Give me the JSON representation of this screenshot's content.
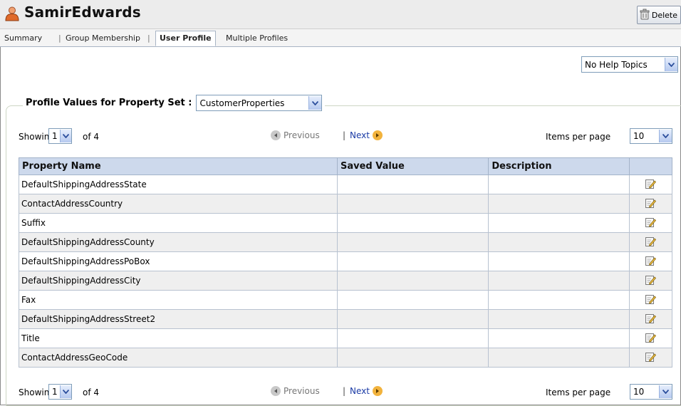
{
  "header": {
    "title": "SamirEdwards",
    "delete_label": "Delete"
  },
  "tabs": [
    {
      "label": "Summary",
      "active": false
    },
    {
      "label": "Group Membership",
      "active": false
    },
    {
      "label": "User Profile",
      "active": true
    },
    {
      "label": "Multiple Profiles",
      "active": false
    }
  ],
  "help": {
    "selected": "No Help Topics"
  },
  "property_set": {
    "label": "Profile Values for Property Set :",
    "selected": "CustomerProperties"
  },
  "pager": {
    "showing_label": "Showing",
    "page": "1",
    "of_label": "of 4",
    "previous_label": "Previous",
    "separator": "|",
    "next_label": "Next",
    "items_per_page_label": "Items per page",
    "items_per_page": "10"
  },
  "table": {
    "columns": [
      "Property Name",
      "Saved Value",
      "Description",
      ""
    ],
    "rows": [
      {
        "name": "DefaultShippingAddressState",
        "value": "",
        "description": ""
      },
      {
        "name": "ContactAddressCountry",
        "value": "",
        "description": ""
      },
      {
        "name": "Suffix",
        "value": "",
        "description": ""
      },
      {
        "name": "DefaultShippingAddressCounty",
        "value": "",
        "description": ""
      },
      {
        "name": "DefaultShippingAddressPoBox",
        "value": "",
        "description": ""
      },
      {
        "name": "DefaultShippingAddressCity",
        "value": "",
        "description": ""
      },
      {
        "name": "Fax",
        "value": "",
        "description": ""
      },
      {
        "name": "DefaultShippingAddressStreet2",
        "value": "",
        "description": ""
      },
      {
        "name": "Title",
        "value": "",
        "description": ""
      },
      {
        "name": "ContactAddressGeoCode",
        "value": "",
        "description": ""
      }
    ]
  },
  "icons": {
    "user": "user-icon",
    "delete": "trash-icon",
    "dropdown": "chevron-down-icon",
    "previous": "arrow-left-circle-icon",
    "next": "arrow-right-circle-icon",
    "edit": "edit-icon"
  },
  "colors": {
    "header_bg": "#ececec",
    "grid_header_bg": "#cdd9ec",
    "alt_row_bg": "#efefef",
    "link": "#1a3aa5"
  }
}
